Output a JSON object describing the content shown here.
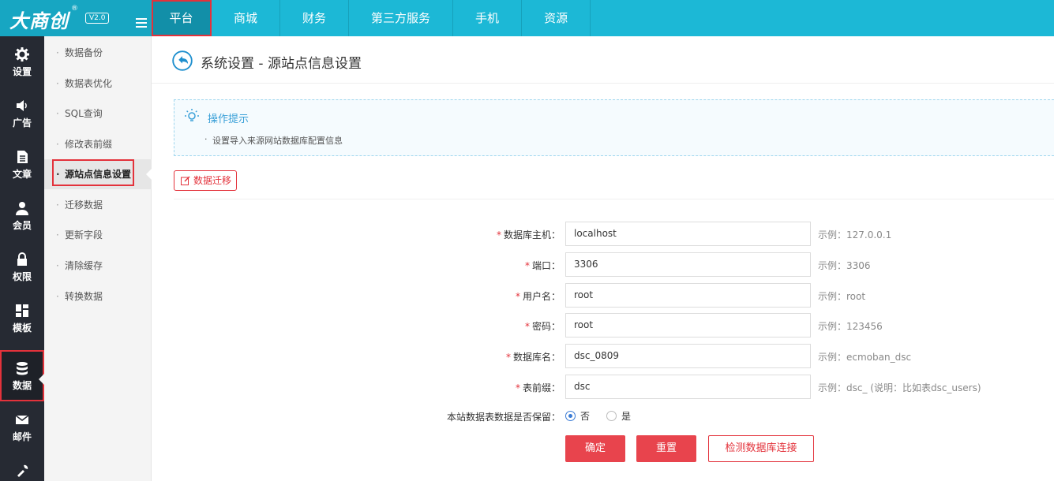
{
  "brand": {
    "name": "大商创",
    "reg_mark": "®",
    "version": "V2.0"
  },
  "top_nav": [
    {
      "label": "平台",
      "active": true
    },
    {
      "label": "商城"
    },
    {
      "label": "财务"
    },
    {
      "label": "第三方服务"
    },
    {
      "label": "手机"
    },
    {
      "label": "资源"
    }
  ],
  "icon_sidebar": [
    {
      "label": "设置",
      "icon": "gear-icon"
    },
    {
      "label": "广告",
      "icon": "speaker-icon"
    },
    {
      "label": "文章",
      "icon": "document-icon"
    },
    {
      "label": "会员",
      "icon": "user-icon"
    },
    {
      "label": "权限",
      "icon": "lock-icon"
    },
    {
      "label": "模板",
      "icon": "grid-icon"
    },
    {
      "label": "数据",
      "icon": "database-icon",
      "active": true
    },
    {
      "label": "邮件",
      "icon": "mail-icon"
    },
    {
      "label": "",
      "icon": "tools-icon"
    }
  ],
  "sub_menu": [
    {
      "label": "数据备份"
    },
    {
      "label": "数据表优化"
    },
    {
      "label": "SQL查询"
    },
    {
      "label": "修改表前缀"
    },
    {
      "label": "源站点信息设置",
      "active": true
    },
    {
      "label": "迁移数据"
    },
    {
      "label": "更新字段"
    },
    {
      "label": "清除缓存"
    },
    {
      "label": "转换数据"
    }
  ],
  "page": {
    "title": "系统设置 - 源站点信息设置"
  },
  "tips": {
    "title": "操作提示",
    "items": [
      "设置导入来源网站数据库配置信息"
    ]
  },
  "migrate_button": "数据迁移",
  "form": {
    "fields": [
      {
        "label": "数据库主机：",
        "value": "localhost",
        "hint": "示例：127.0.0.1"
      },
      {
        "label": "端口：",
        "value": "3306",
        "hint": "示例：3306"
      },
      {
        "label": "用户名：",
        "value": "root",
        "hint": "示例：root"
      },
      {
        "label": "密码：",
        "value": "root",
        "hint": "示例：123456"
      },
      {
        "label": "数据库名：",
        "value": "dsc_0809",
        "hint": "示例：ecmoban_dsc"
      },
      {
        "label": "表前缀：",
        "value": "dsc",
        "hint": "示例：dsc_ (说明：比如表dsc_users)"
      }
    ],
    "required_mark": "*",
    "keep_data": {
      "label": "本站数据表数据是否保留：",
      "options": [
        "否",
        "是"
      ],
      "selected": "否"
    },
    "buttons": {
      "confirm": "确定",
      "reset": "重置",
      "check": "检测数据库连接"
    }
  },
  "colors": {
    "topbar": "#1cb8d6",
    "sidebar": "#262a33",
    "accent_red": "#e3323b",
    "tip_blue": "#3aa0d8"
  }
}
